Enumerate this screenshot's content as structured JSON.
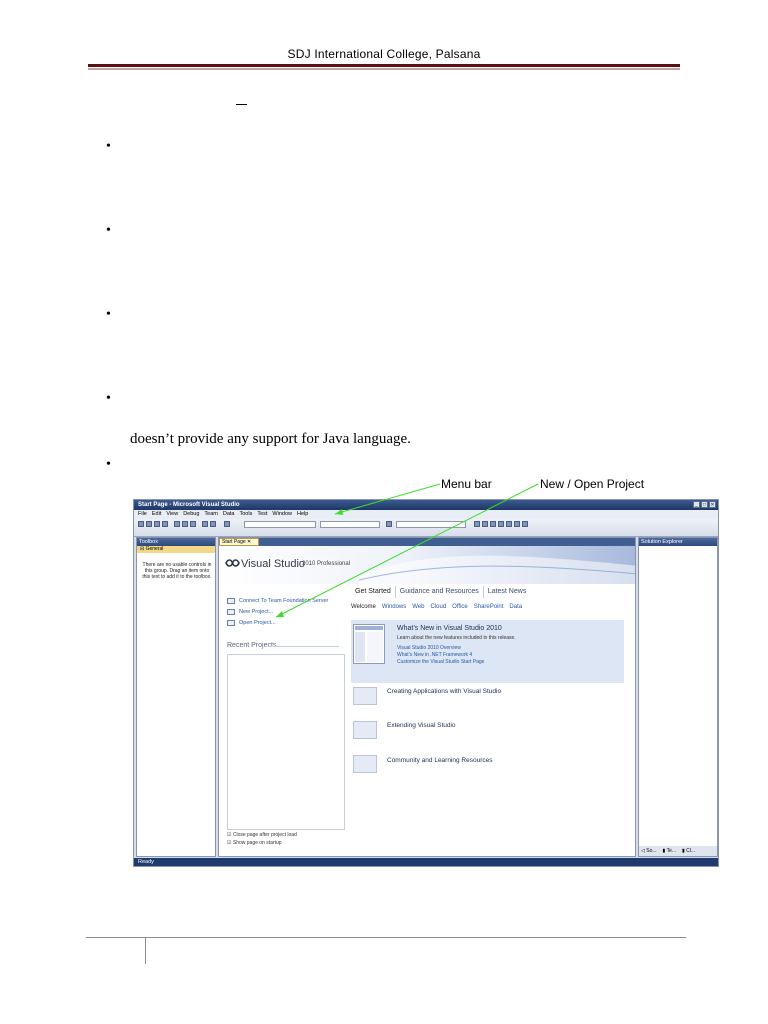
{
  "header": {
    "college": "SDJ International College, Palsana"
  },
  "bullets": [
    "•",
    "•",
    "•",
    "•",
    "•"
  ],
  "body_text": "doesn’t provide any support for Java language.",
  "annotations": {
    "menu_bar": "Menu bar",
    "new_open_project": "New / Open Project"
  },
  "screenshot": {
    "window_title": "Start Page - Microsoft Visual Studio",
    "window_buttons": [
      "_",
      "□",
      "✕"
    ],
    "menu": [
      "File",
      "Edit",
      "View",
      "Debug",
      "Team",
      "Data",
      "Tools",
      "Test",
      "Window",
      "Help"
    ],
    "toolbox": {
      "title": "Toolbox",
      "group": "⊟ General",
      "message": "There are no usable controls in this group. Drag an item onto this text to add it to the toolbox."
    },
    "doc_tab": "Start Page ✕",
    "logo": {
      "name": "Visual Studio",
      "edition": "2010 Professional"
    },
    "left_links": [
      "Connect To Team Foundation Server",
      "New Project...",
      "Open Project..."
    ],
    "recent_projects_heading": "Recent Projects",
    "checkboxes": [
      "☑ Close page after project load",
      "☑ Show page on startup"
    ],
    "tabs": [
      "Get Started",
      "Guidance and Resources",
      "Latest News"
    ],
    "subnav": [
      "Welcome",
      "Windows",
      "Web",
      "Cloud",
      "Office",
      "SharePoint",
      "Data"
    ],
    "feature": {
      "title": "What’s New in Visual Studio 2010",
      "description": "Learn about the new features included in this release.",
      "links": [
        "Visual Studio 2010 Overview",
        "What’s New in .NET Framework 4",
        "Customize the Visual Studio Start Page"
      ]
    },
    "items": [
      "Creating Applications with Visual Studio",
      "Extending Visual Studio",
      "Community and Learning Resources"
    ],
    "solution_explorer": {
      "title": "Solution Explorer",
      "tabs": [
        "◁ So...",
        "▮ Te...",
        "▮ Cl..."
      ]
    },
    "status": "Ready"
  }
}
